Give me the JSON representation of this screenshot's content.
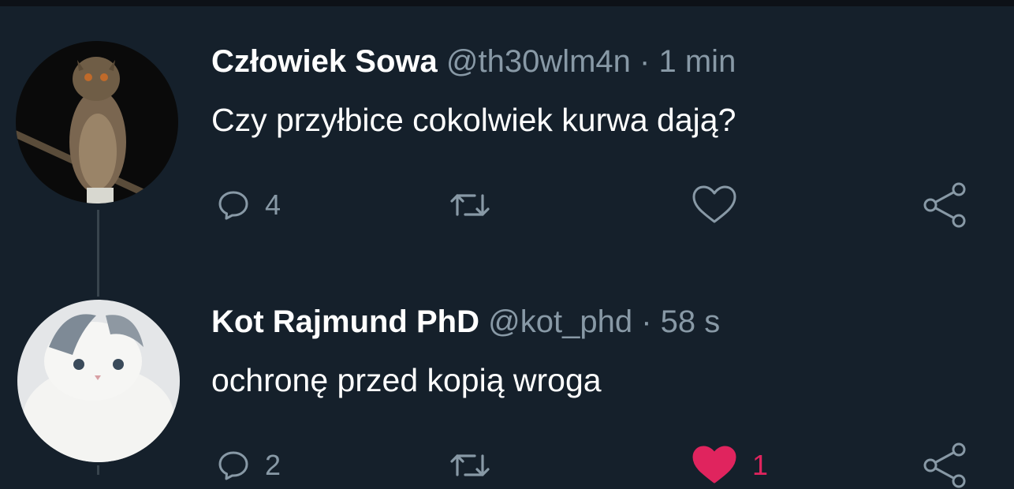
{
  "colors": {
    "background": "#15202b",
    "secondary_text": "#8899a6",
    "like_active": "#e0245e",
    "thread_line": "#38444d"
  },
  "tweets": [
    {
      "name": "Człowiek Sowa",
      "handle": "@th30wlm4n",
      "separator": "·",
      "time": "1 min",
      "text": "Czy przyłbice cokolwiek kurwa dają?",
      "reply_count": "4",
      "retweet_count": "",
      "like_count": "",
      "liked": false,
      "avatar_icon": "owl-avatar"
    },
    {
      "name": "Kot Rajmund PhD",
      "handle": "@kot_phd",
      "separator": "·",
      "time": "58 s",
      "text": "ochronę przed kopią wroga",
      "reply_count": "2",
      "retweet_count": "",
      "like_count": "1",
      "liked": true,
      "avatar_icon": "cat-avatar"
    }
  ],
  "icons": [
    "reply-icon",
    "retweet-icon",
    "like-icon",
    "share-icon"
  ]
}
